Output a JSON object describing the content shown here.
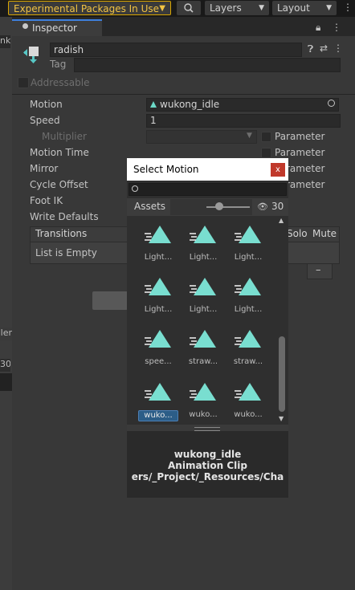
{
  "toolbar": {
    "experimental_packages": "Experimental Packages In Use",
    "layers": "Layers",
    "layout": "Layout"
  },
  "left_panel": {
    "partial_label_top": "nk",
    "partial_label_mid": "ler",
    "partial_value": "30"
  },
  "inspector": {
    "tab_label": "Inspector",
    "object_name": "radish",
    "tag_label": "Tag",
    "tag_value": "",
    "addressable_label": "Addressable",
    "properties": {
      "motion_label": "Motion",
      "motion_value": "wukong_idle",
      "speed_label": "Speed",
      "speed_value": "1",
      "multiplier_label": "Multiplier",
      "motion_time_label": "Motion Time",
      "mirror_label": "Mirror",
      "cycle_offset_label": "Cycle Offset",
      "foot_ik_label": "Foot IK",
      "write_defaults_label": "Write Defaults",
      "parameter_label": "Parameter",
      "param_partial": "rameter"
    },
    "transitions": {
      "header": "Transitions",
      "solo": "Solo",
      "mute": "Mute",
      "empty_text": "List is Empty",
      "remove_label": "–"
    }
  },
  "select_motion": {
    "title": "Select Motion",
    "close_label": "x",
    "search_value": "",
    "assets_label": "Assets",
    "hidden_count": "30",
    "items": [
      {
        "label": "Light..."
      },
      {
        "label": "Light..."
      },
      {
        "label": "Light..."
      },
      {
        "label": "Light..."
      },
      {
        "label": "Light..."
      },
      {
        "label": "Light..."
      },
      {
        "label": "spee..."
      },
      {
        "label": "straw..."
      },
      {
        "label": "straw..."
      },
      {
        "label": "wuko...",
        "selected": true
      },
      {
        "label": "wuko..."
      },
      {
        "label": "wuko..."
      }
    ],
    "preview": {
      "name": "wukong_idle",
      "type": "Animation Clip",
      "path": "ers/_Project/_Resources/Cha"
    }
  }
}
